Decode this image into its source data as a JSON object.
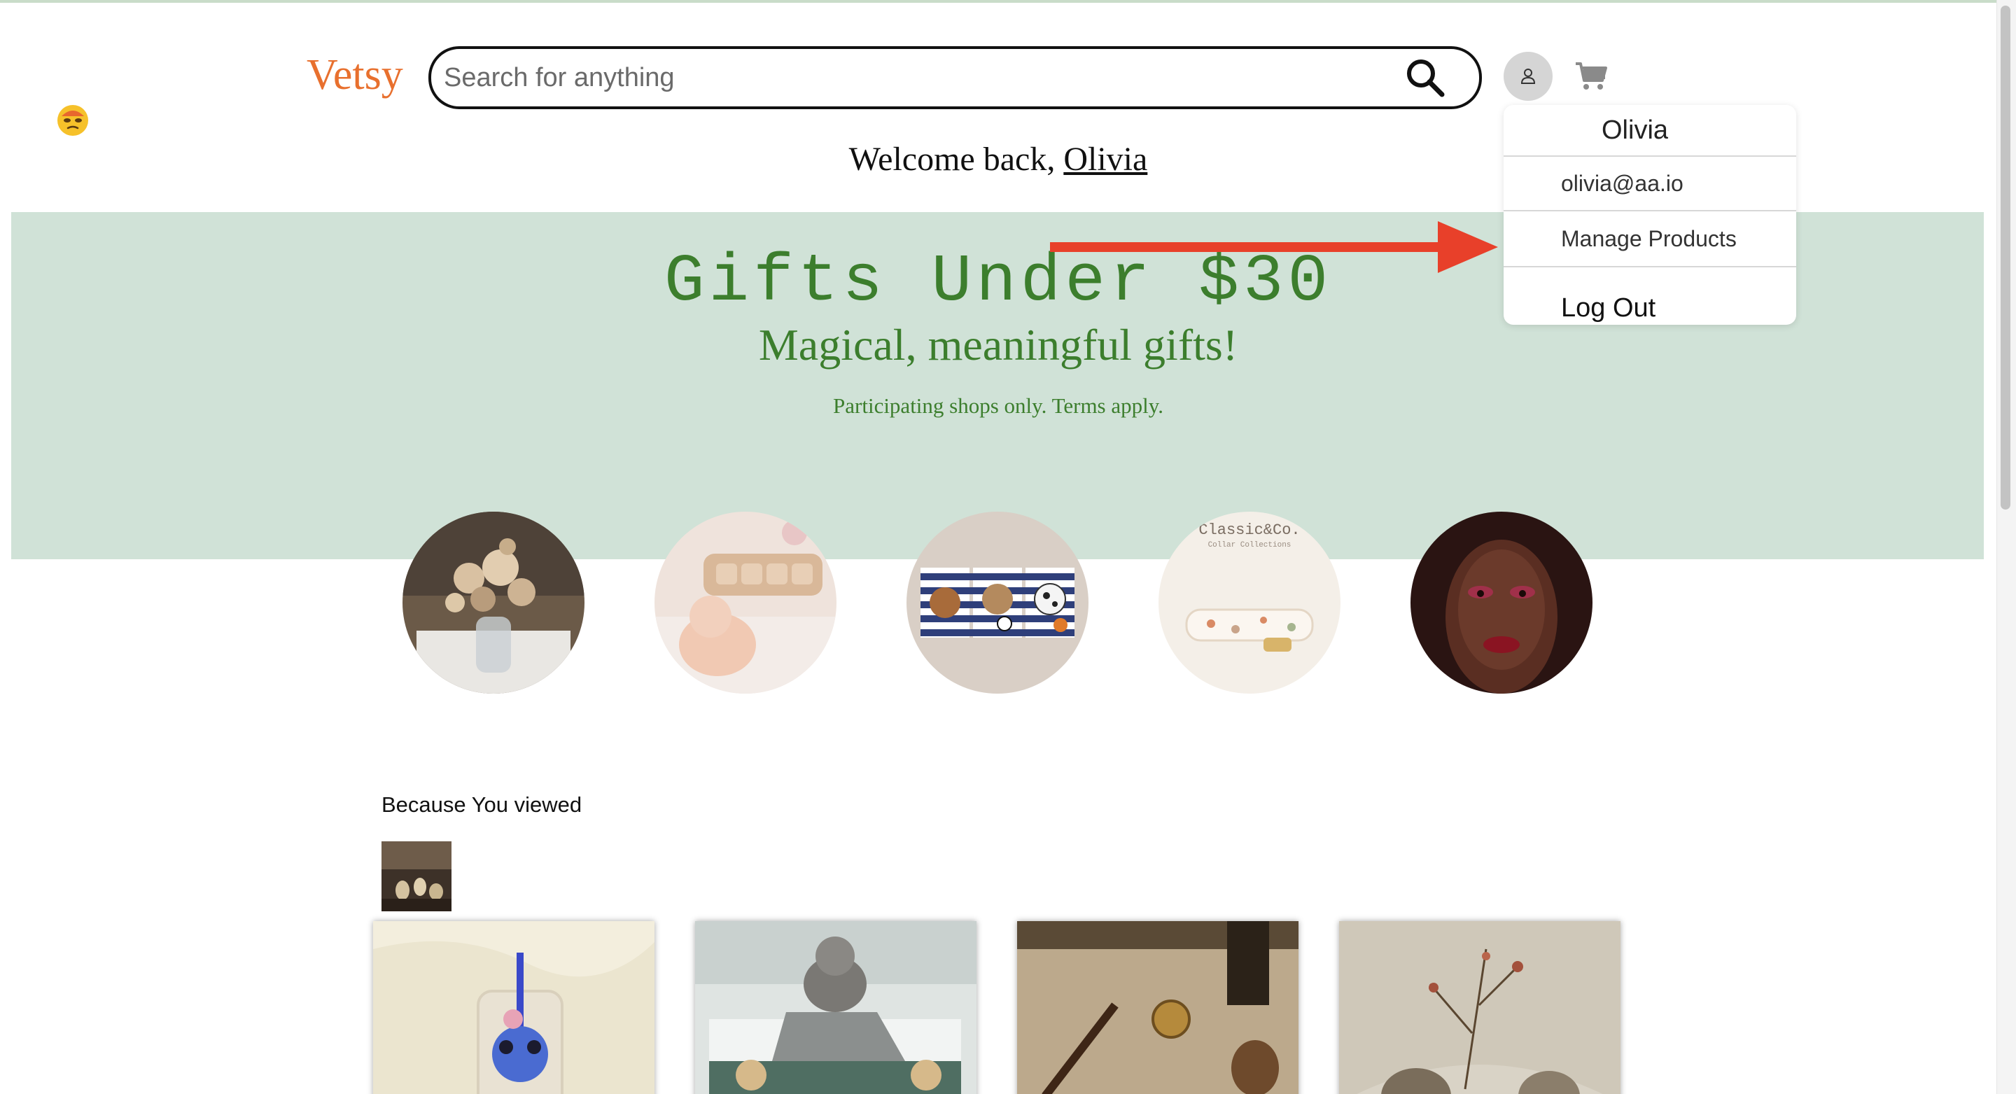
{
  "header": {
    "logo": "Vetsy",
    "search_placeholder": "Search for anything"
  },
  "welcome": {
    "prefix": "Welcome back, ",
    "name": "Olivia"
  },
  "banner": {
    "title": "Gifts Under $30",
    "subtitle": "Magical, meaningful gifts!",
    "terms": "Participating shops only. Terms apply.",
    "background": "#d0e2d7",
    "text_color": "#3c7e2d"
  },
  "categories": [
    {
      "name": "dried-flower-bouquet"
    },
    {
      "name": "baby-name-puzzle"
    },
    {
      "name": "sports-puppies-print"
    },
    {
      "name": "dog-collar"
    },
    {
      "name": "makeup-portrait"
    }
  ],
  "recommendations": {
    "title": "Because You viewed",
    "products": [
      {
        "name": "stitch-glass-cup"
      },
      {
        "name": "kids-room-teddy"
      },
      {
        "name": "wizard-wand-compass"
      },
      {
        "name": "dried-branch-vases"
      }
    ]
  },
  "user_menu": {
    "name": "Olivia",
    "email": "olivia@aa.io",
    "manage_products": "Manage Products",
    "logout": "Log Out"
  },
  "colors": {
    "logo": "#e8702e",
    "arrow": "#e8402a",
    "accent_green": "#3c7e2d"
  }
}
